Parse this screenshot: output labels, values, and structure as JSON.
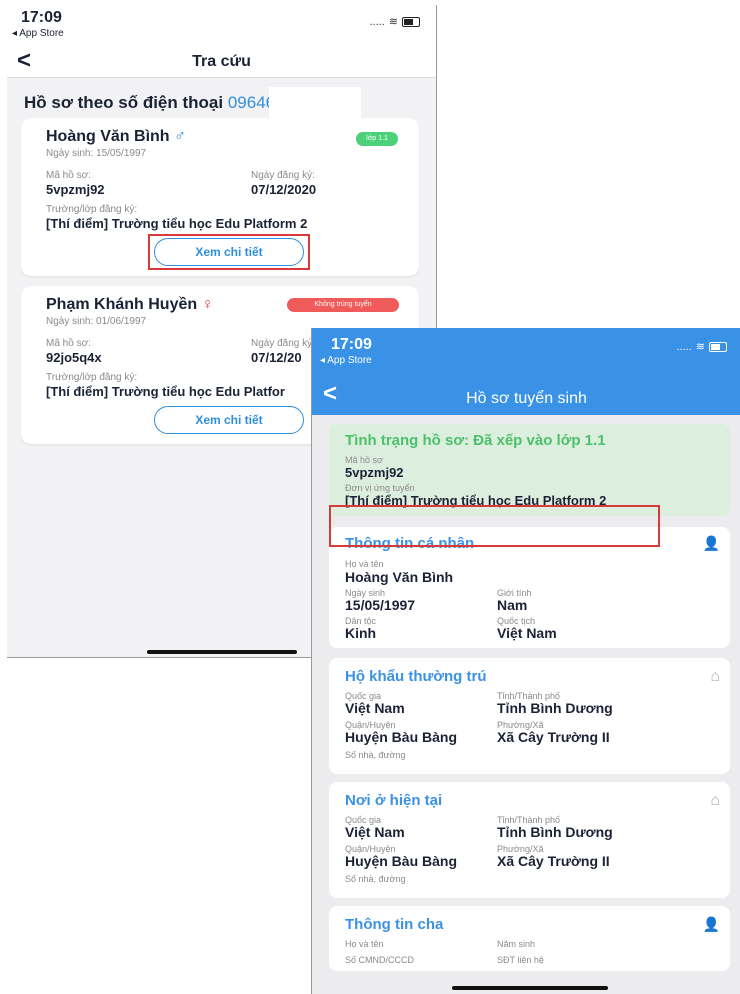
{
  "screen1": {
    "status": {
      "time": "17:09",
      "back_app": "◂ App Store",
      "signal": "..... ",
      "wifi": "≋"
    },
    "nav": {
      "back": "<",
      "title": "Tra cứu"
    },
    "header": {
      "label": "Hồ sơ theo số điện thoại ",
      "phone": "09646"
    },
    "cards": [
      {
        "name": "Hoàng Văn Bình",
        "gender_symbol": "♂",
        "dob": "Ngày sinh: 15/05/1997",
        "badge": "lớp 1.1",
        "badge_color": "#4cd17a",
        "code_label": "Mã hồ sơ:",
        "code": "5vpzmj92",
        "reg_date_label": "Ngày đăng ký:",
        "reg_date": "07/12/2020",
        "school_label": "Trường/lớp đăng ký:",
        "school": "[Thí điểm] Trường tiểu học Edu Platform 2",
        "button": "Xem chi tiết"
      },
      {
        "name": "Phạm Khánh Huyền",
        "gender_symbol": "♀",
        "dob": "Ngày sinh: 01/06/1997",
        "badge": "Không trúng tuyển",
        "badge_color": "#ef5a5a",
        "code_label": "Mã hồ sơ:",
        "code": "92jo5q4x",
        "reg_date_label": "Ngày đăng ký:",
        "reg_date": "07/12/20",
        "school_label": "Trường/lớp đăng ký:",
        "school": "[Thí điểm] Trường tiểu học Edu Platfor",
        "button": "Xem chi tiết"
      }
    ]
  },
  "screen2": {
    "status": {
      "time": "17:09",
      "back_app": "◂ App Store",
      "signal": "..... ",
      "wifi": "≋"
    },
    "nav": {
      "back": "<",
      "title": "Hồ sơ tuyển sinh"
    },
    "status_card": {
      "title": "Tình trạng hồ sơ: Đã xếp vào lớp 1.1",
      "code_label": "Mã hồ sơ",
      "code": "5vpzmj92",
      "unit_label": "Đơn vị ứng tuyển",
      "unit": "[Thí điểm] Trường tiểu học Edu Platform 2"
    },
    "personal": {
      "title": "Thông tin cá nhân",
      "name_label": "Họ và tên",
      "name": "Hoàng Văn Bình",
      "dob_label": "Ngày sinh",
      "dob": "15/05/1997",
      "gender_label": "Giới tính",
      "gender": "Nam",
      "ethnic_label": "Dân tộc",
      "ethnic": "Kinh",
      "nationality_label": "Quốc tịch",
      "nationality": "Việt Nam"
    },
    "household": {
      "title": "Hộ khẩu thường trú",
      "country_label": "Quốc gia",
      "country": "Việt Nam",
      "province_label": "Tỉnh/Thành phố",
      "province": "Tỉnh Bình Dương",
      "district_label": "Quận/Huyện",
      "district": "Huyện Bàu Bàng",
      "ward_label": "Phường/Xã",
      "ward": "Xã Cây Trường II",
      "street_label": "Số nhà, đường"
    },
    "current": {
      "title": "Nơi ở hiện tại",
      "country_label": "Quốc gia",
      "country": "Việt Nam",
      "province_label": "Tỉnh/Thành phố",
      "province": "Tỉnh Bình Dương",
      "district_label": "Quận/Huyện",
      "district": "Huyện Bàu Bàng",
      "ward_label": "Phường/Xã",
      "ward": "Xã Cây Trường II",
      "street_label": "Số nhà, đường"
    },
    "father": {
      "title": "Thông tin cha",
      "name_label": "Họ và tên",
      "birth_year_label": "Năm sinh",
      "id_label": "Số CMND/CCCD",
      "phone_label": "SĐT liên hệ"
    }
  },
  "icons": {
    "person": "👤",
    "home": "⌂"
  },
  "colors": {
    "accent": "#3a92e6",
    "highlight": "#d83a3a",
    "status_bg": "#dcefdf"
  }
}
